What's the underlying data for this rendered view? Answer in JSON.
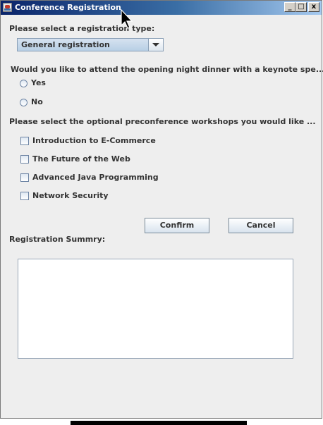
{
  "window": {
    "title": "Conference Registration",
    "buttons": {
      "minimize": "_",
      "maximize": "□",
      "close": "x"
    }
  },
  "form": {
    "registration_type_label": "Please select a registration type:",
    "registration_type_value": "General registration",
    "dinner_question": "Would you like to attend the opening night dinner with a keynote spe...",
    "dinner_options": [
      "Yes",
      "No"
    ],
    "workshops_label": "Please select the optional preconference workshops you would like ...",
    "workshops": [
      "Introduction to E-Commerce",
      "The Future of the Web",
      "Advanced Java Programming",
      "Network Security"
    ],
    "confirm_label": "Confirm",
    "cancel_label": "Cancel",
    "summary_label": "Registration Summry:",
    "summary_text": ""
  },
  "colors": {
    "titlebar_start": "#0a246a",
    "titlebar_end": "#a6caf0",
    "window_bg": "#eeeeee",
    "control_accent": "#b8cfe5"
  }
}
